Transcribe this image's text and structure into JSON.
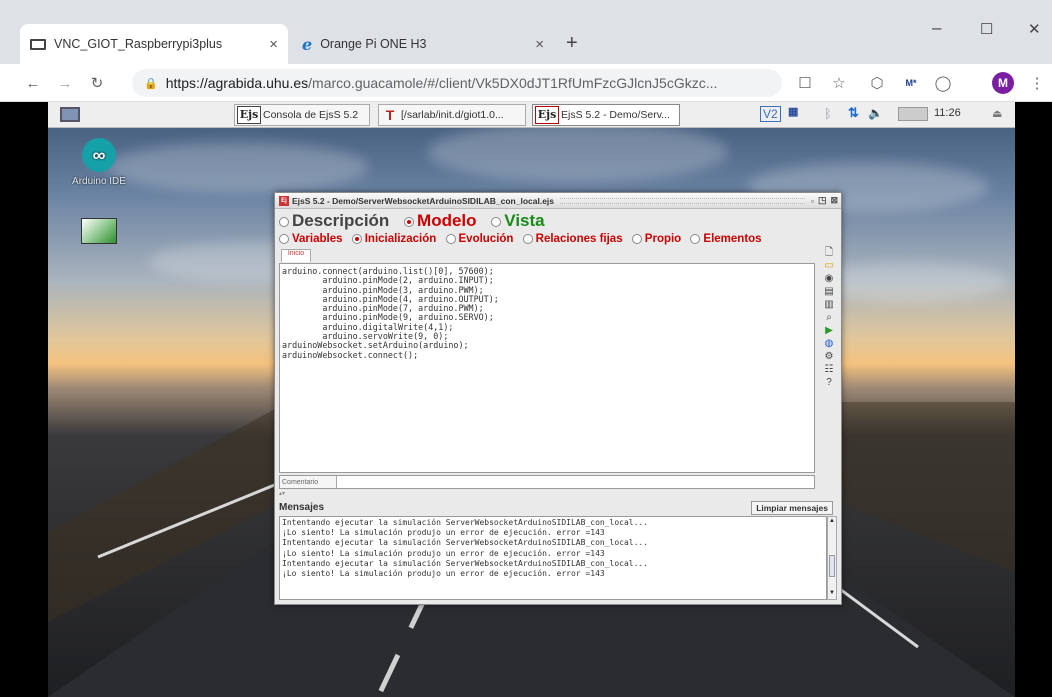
{
  "browser": {
    "tabs": [
      {
        "title": "VNC_GIOT_Raspberrypi3plus",
        "close": "×"
      },
      {
        "title": "Orange Pi ONE H3",
        "close": "×"
      }
    ],
    "new_tab": "+",
    "url_host": "https://agrabida.uhu.es",
    "url_path": "/marco.guacamole/#/client/Vk5DX0dJT1RfUmFzcGJlcnJ5cGkzc...",
    "avatar_letter": "M",
    "window_controls": {
      "minimize": "–",
      "maximize": "☐",
      "close": "✕"
    }
  },
  "taskbar": {
    "buttons": [
      {
        "icon": "Ejs",
        "label": "Consola de EjsS 5.2"
      },
      {
        "icon": "T",
        "label": "[/sarlab/init.d/giot1.0..."
      },
      {
        "icon": "Ejs",
        "label": "EjsS 5.2 - Demo/Serv..."
      }
    ],
    "time": "11:26",
    "vnc_label": "V2"
  },
  "desktop": {
    "icons": [
      {
        "label": "Arduino IDE"
      },
      {
        "label": ""
      }
    ]
  },
  "ejs": {
    "title": "EjsS 5.2 - Demo/ServerWebsocketArduinoSIDILAB_con_local.ejs",
    "main_tabs": {
      "descripcion": "Descripción",
      "modelo": "Modelo",
      "vista": "Vista"
    },
    "sub_tabs": {
      "variables": "Variables",
      "inicializacion": "Inicialización",
      "evolucion": "Evolución",
      "relaciones": "Relaciones fijas",
      "propio": "Propio",
      "elementos": "Elementos"
    },
    "page_tab": "Inicio",
    "code": [
      "arduino.connect(arduino.list()[0], 57600);",
      "        arduino.pinMode(2, arduino.INPUT);",
      "        arduino.pinMode(3, arduino.PWM);",
      "        arduino.pinMode(4, arduino.OUTPUT);",
      "        arduino.pinMode(7, arduino.PWM);",
      "        arduino.pinMode(9, arduino.SERVO);",
      "        arduino.digitalWrite(4,1);",
      "        arduino.servoWrite(9, 0);",
      "arduinoWebsocket.setArduino(arduino);",
      "arduinoWebsocket.connect();"
    ],
    "comment_label": "Comentario",
    "messages_title": "Mensajes",
    "clear_button": "Limpiar mensajes",
    "messages": [
      "Intentando ejecutar la simulación ServerWebsocketArduinoSIDILAB_con_local...",
      "¡Lo siento! La simulación produjo un error de ejecución. error =143",
      "Intentando ejecutar la simulación ServerWebsocketArduinoSIDILAB_con_local...",
      "¡Lo siento! La simulación produjo un error de ejecución. error =143",
      "Intentando ejecutar la simulación ServerWebsocketArduinoSIDILAB_con_local...",
      "¡Lo siento! La simulación produjo un error de ejecución. error =143"
    ]
  }
}
